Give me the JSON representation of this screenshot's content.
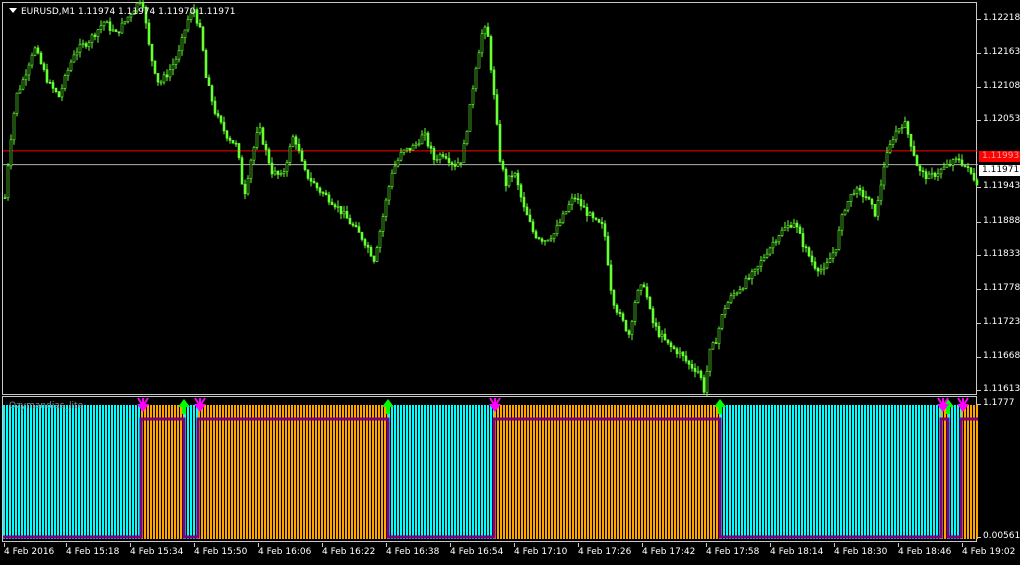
{
  "window": {
    "symbol_header": "EURUSD,M1  1.11974  1.11974  1.11970  1.11971"
  },
  "indicator": {
    "name": "Ozymandias_lite",
    "scale_top": "1.1777",
    "scale_bottom": "0.00561",
    "scale_bottom_overlap": "0.0056"
  },
  "price_axis": {
    "labels": [
      "1.12218",
      "1.12163",
      "1.12108",
      "1.12053",
      "1.11998",
      "1.11943",
      "1.11888",
      "1.11833",
      "1.11778",
      "1.11723",
      "1.11668",
      "1.11613"
    ],
    "bid_line": "1.11971",
    "red_line": "1.11993"
  },
  "time_axis": {
    "labels": [
      "4 Feb 2016",
      "4 Feb 15:18",
      "4 Feb 15:34",
      "4 Feb 15:50",
      "4 Feb 16:06",
      "4 Feb 16:22",
      "4 Feb 16:38",
      "4 Feb 16:54",
      "4 Feb 17:10",
      "4 Feb 17:26",
      "4 Feb 17:42",
      "4 Feb 17:58",
      "4 Feb 18:14",
      "4 Feb 18:30",
      "4 Feb 18:46",
      "4 Feb 19:02"
    ]
  },
  "colors": {
    "candle": "#66ff33",
    "up_trend": "#00ffff",
    "down_trend": "#ffa500",
    "line": "#800080",
    "buy_arrow": "#00ff00",
    "sell_arrow": "#ff00ff",
    "red_level": "#ff0000"
  },
  "chart_data": {
    "type": "line",
    "title": "EURUSD,M1",
    "ylim": [
      1.116,
      1.1223
    ],
    "price_path": [
      [
        0,
        1.119
      ],
      [
        5,
        1.1199
      ],
      [
        12,
        1.1208
      ],
      [
        20,
        1.1211
      ],
      [
        30,
        1.1216
      ],
      [
        45,
        1.121
      ],
      [
        55,
        1.1208
      ],
      [
        70,
        1.1215
      ],
      [
        85,
        1.1217
      ],
      [
        100,
        1.122
      ],
      [
        112,
        1.1218
      ],
      [
        125,
        1.1221
      ],
      [
        138,
        1.1224
      ],
      [
        146,
        1.1215
      ],
      [
        155,
        1.121
      ],
      [
        165,
        1.1212
      ],
      [
        175,
        1.1215
      ],
      [
        183,
        1.122
      ],
      [
        190,
        1.1222
      ],
      [
        197,
        1.1218
      ],
      [
        202,
        1.1211
      ],
      [
        212,
        1.1205
      ],
      [
        222,
        1.1202
      ],
      [
        233,
        1.12
      ],
      [
        240,
        1.1192
      ],
      [
        247,
        1.1198
      ],
      [
        255,
        1.1203
      ],
      [
        268,
        1.1196
      ],
      [
        278,
        1.1195
      ],
      [
        290,
        1.1202
      ],
      [
        300,
        1.1196
      ],
      [
        315,
        1.1193
      ],
      [
        330,
        1.1191
      ],
      [
        345,
        1.1188
      ],
      [
        360,
        1.1185
      ],
      [
        370,
        1.1182
      ],
      [
        378,
        1.1188
      ],
      [
        388,
        1.1196
      ],
      [
        398,
        1.1199
      ],
      [
        410,
        1.12
      ],
      [
        420,
        1.1202
      ],
      [
        430,
        1.1198
      ],
      [
        440,
        1.1199
      ],
      [
        450,
        1.1197
      ],
      [
        458,
        1.1198
      ],
      [
        465,
        1.1205
      ],
      [
        472,
        1.1213
      ],
      [
        478,
        1.1218
      ],
      [
        483,
        1.1219
      ],
      [
        490,
        1.1208
      ],
      [
        496,
        1.1198
      ],
      [
        502,
        1.1194
      ],
      [
        510,
        1.1196
      ],
      [
        520,
        1.119
      ],
      [
        530,
        1.1186
      ],
      [
        540,
        1.1185
      ],
      [
        550,
        1.1186
      ],
      [
        560,
        1.1189
      ],
      [
        570,
        1.1192
      ],
      [
        580,
        1.119
      ],
      [
        590,
        1.1188
      ],
      [
        600,
        1.1187
      ],
      [
        608,
        1.1176
      ],
      [
        615,
        1.1173
      ],
      [
        625,
        1.117
      ],
      [
        632,
        1.1176
      ],
      [
        640,
        1.1178
      ],
      [
        648,
        1.1172
      ],
      [
        655,
        1.117
      ],
      [
        665,
        1.1168
      ],
      [
        675,
        1.1167
      ],
      [
        685,
        1.1165
      ],
      [
        695,
        1.1164
      ],
      [
        700,
        1.1161
      ],
      [
        706,
        1.1167
      ],
      [
        712,
        1.1169
      ],
      [
        720,
        1.1174
      ],
      [
        728,
        1.1176
      ],
      [
        740,
        1.1178
      ],
      [
        752,
        1.118
      ],
      [
        762,
        1.1183
      ],
      [
        775,
        1.1186
      ],
      [
        790,
        1.1188
      ],
      [
        800,
        1.1184
      ],
      [
        810,
        1.1181
      ],
      [
        820,
        1.118
      ],
      [
        832,
        1.1184
      ],
      [
        840,
        1.119
      ],
      [
        850,
        1.1193
      ],
      [
        862,
        1.1192
      ],
      [
        872,
        1.1189
      ],
      [
        880,
        1.1197
      ],
      [
        890,
        1.1202
      ],
      [
        900,
        1.1204
      ],
      [
        908,
        1.12
      ],
      [
        915,
        1.1196
      ],
      [
        925,
        1.1195
      ],
      [
        935,
        1.1196
      ],
      [
        945,
        1.1197
      ],
      [
        955,
        1.1198
      ],
      [
        965,
        1.1196
      ],
      [
        975,
        1.1194
      ]
    ],
    "indicator_segments": [
      {
        "state": "up",
        "from": 0,
        "to": 138
      },
      {
        "state": "down",
        "from": 138,
        "to": 181
      },
      {
        "state": "up",
        "from": 181,
        "to": 195
      },
      {
        "state": "down",
        "from": 195,
        "to": 385
      },
      {
        "state": "up",
        "from": 385,
        "to": 491
      },
      {
        "state": "down",
        "from": 491,
        "to": 717
      },
      {
        "state": "up",
        "from": 717,
        "to": 938
      },
      {
        "state": "down",
        "from": 938,
        "to": 945
      },
      {
        "state": "up",
        "from": 945,
        "to": 958
      },
      {
        "state": "down",
        "from": 958,
        "to": 975
      }
    ],
    "buy_arrows_at": [
      181,
      385,
      717,
      945
    ],
    "sell_arrows_at": [
      140,
      197,
      492,
      940,
      960
    ]
  }
}
